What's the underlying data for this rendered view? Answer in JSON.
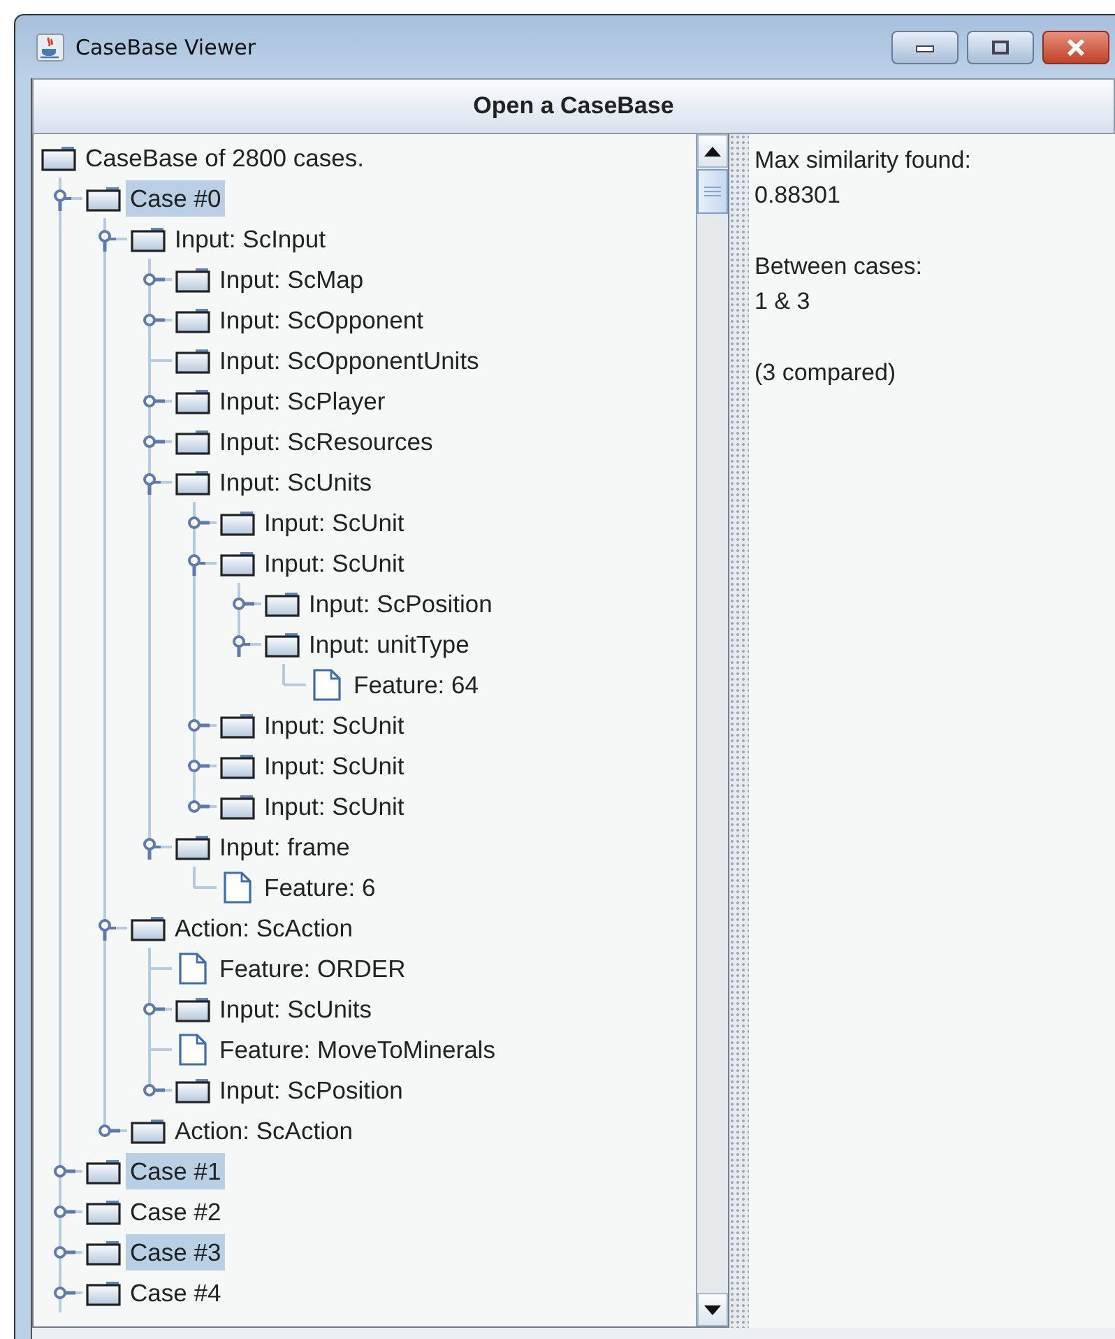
{
  "window": {
    "title": "CaseBase Viewer"
  },
  "open_button": {
    "label": "Open a CaseBase"
  },
  "tree": {
    "root": {
      "label": "CaseBase of 2800 cases.",
      "kind": "folder",
      "selected": false,
      "children": [
        {
          "label": "Case #0",
          "kind": "folder",
          "expandable": true,
          "expanded": true,
          "selected": true,
          "children": [
            {
              "label": "Input: ScInput",
              "kind": "folder",
              "expandable": true,
              "expanded": true,
              "selected": false,
              "children": [
                {
                  "label": "Input: ScMap",
                  "kind": "folder",
                  "expandable": true,
                  "expanded": false,
                  "selected": false
                },
                {
                  "label": "Input: ScOpponent",
                  "kind": "folder",
                  "expandable": true,
                  "expanded": false,
                  "selected": false
                },
                {
                  "label": "Input: ScOpponentUnits",
                  "kind": "folder",
                  "expandable": false,
                  "selected": false
                },
                {
                  "label": "Input: ScPlayer",
                  "kind": "folder",
                  "expandable": true,
                  "expanded": false,
                  "selected": false
                },
                {
                  "label": "Input: ScResources",
                  "kind": "folder",
                  "expandable": true,
                  "expanded": false,
                  "selected": false
                },
                {
                  "label": "Input: ScUnits",
                  "kind": "folder",
                  "expandable": true,
                  "expanded": true,
                  "selected": false,
                  "children": [
                    {
                      "label": "Input: ScUnit",
                      "kind": "folder",
                      "expandable": true,
                      "expanded": false,
                      "selected": false
                    },
                    {
                      "label": "Input: ScUnit",
                      "kind": "folder",
                      "expandable": true,
                      "expanded": true,
                      "selected": false,
                      "children": [
                        {
                          "label": "Input: ScPosition",
                          "kind": "folder",
                          "expandable": true,
                          "expanded": false,
                          "selected": false
                        },
                        {
                          "label": "Input: unitType",
                          "kind": "folder",
                          "expandable": true,
                          "expanded": true,
                          "selected": false,
                          "children": [
                            {
                              "label": "Feature: 64",
                              "kind": "feature",
                              "expandable": false,
                              "selected": false
                            }
                          ]
                        }
                      ]
                    },
                    {
                      "label": "Input: ScUnit",
                      "kind": "folder",
                      "expandable": true,
                      "expanded": false,
                      "selected": false
                    },
                    {
                      "label": "Input: ScUnit",
                      "kind": "folder",
                      "expandable": true,
                      "expanded": false,
                      "selected": false
                    },
                    {
                      "label": "Input: ScUnit",
                      "kind": "folder",
                      "expandable": true,
                      "expanded": false,
                      "selected": false
                    }
                  ]
                },
                {
                  "label": "Input: frame",
                  "kind": "folder",
                  "expandable": true,
                  "expanded": true,
                  "selected": false,
                  "children": [
                    {
                      "label": "Feature: 6",
                      "kind": "feature",
                      "expandable": false,
                      "selected": false
                    }
                  ]
                }
              ]
            },
            {
              "label": "Action: ScAction",
              "kind": "folder",
              "expandable": true,
              "expanded": true,
              "selected": false,
              "children": [
                {
                  "label": "Feature: ORDER",
                  "kind": "feature",
                  "expandable": false,
                  "selected": false
                },
                {
                  "label": "Input: ScUnits",
                  "kind": "folder",
                  "expandable": true,
                  "expanded": false,
                  "selected": false
                },
                {
                  "label": "Feature: MoveToMinerals",
                  "kind": "feature",
                  "expandable": false,
                  "selected": false
                },
                {
                  "label": "Input: ScPosition",
                  "kind": "folder",
                  "expandable": true,
                  "expanded": false,
                  "selected": false
                }
              ]
            },
            {
              "label": "Action: ScAction",
              "kind": "folder",
              "expandable": true,
              "expanded": false,
              "selected": false
            }
          ]
        },
        {
          "label": "Case #1",
          "kind": "folder",
          "expandable": true,
          "expanded": false,
          "selected": true
        },
        {
          "label": "Case #2",
          "kind": "folder",
          "expandable": true,
          "expanded": false,
          "selected": false
        },
        {
          "label": "Case #3",
          "kind": "folder",
          "expandable": true,
          "expanded": false,
          "selected": true
        },
        {
          "label": "Case #4",
          "kind": "folder",
          "expandable": true,
          "expanded": false,
          "selected": false,
          "continues": true
        }
      ]
    }
  },
  "info": [
    [
      "Max similarity found:",
      "0.88301"
    ],
    [
      "Between cases:",
      "1 & 3"
    ],
    [
      "(3 compared)"
    ]
  ]
}
